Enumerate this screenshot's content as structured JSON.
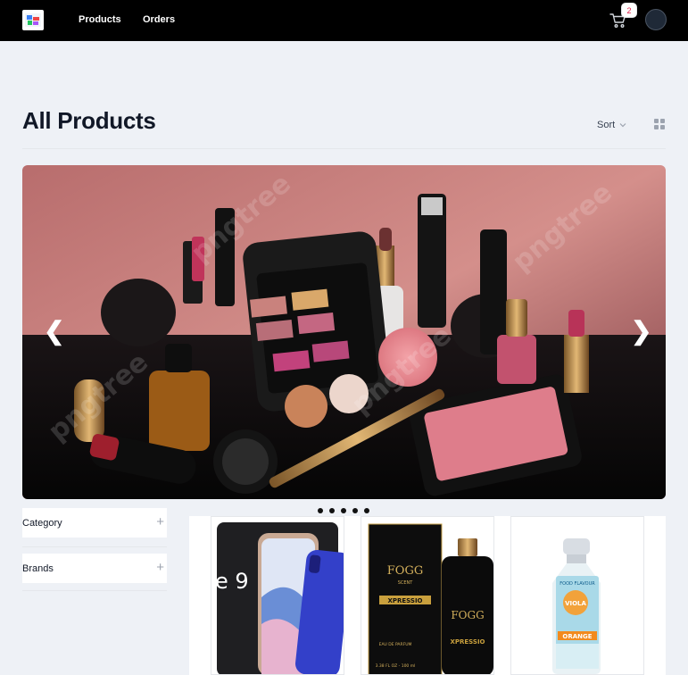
{
  "header": {
    "logo_icon": "store-logo-icon",
    "nav": [
      {
        "label": "Products"
      },
      {
        "label": "Orders"
      }
    ],
    "cart_count": "2",
    "cart_icon": "shopping-cart-icon",
    "avatar_icon": "user-avatar"
  },
  "page": {
    "title": "All Products",
    "sort_label": "Sort",
    "view_icon": "grid-view-icon"
  },
  "carousel": {
    "prev_label": "❮",
    "next_label": "❯",
    "slide_count": 5,
    "active_slide": 1,
    "watermark": "pngtree"
  },
  "filters": [
    {
      "label": "Category",
      "icon": "plus-icon"
    },
    {
      "label": "Brands",
      "icon": "plus-icon"
    }
  ],
  "products": {
    "phone_text": "e 9",
    "fogg_brand": "FOGG",
    "fogg_sub": "SCENT",
    "fogg_name": "XPRESSIO",
    "fogg_type": "EAU DE PARFUM",
    "fogg_volume": "3.38 FL OZ - 100 ml",
    "food_label": "FOOD FLAVOUR",
    "food_brand": "VIOLA",
    "food_flavour": "ORANGE"
  },
  "colors": {
    "header_bg": "#000000",
    "page_bg": "#eef1f6",
    "badge_text": "#e11d48"
  }
}
